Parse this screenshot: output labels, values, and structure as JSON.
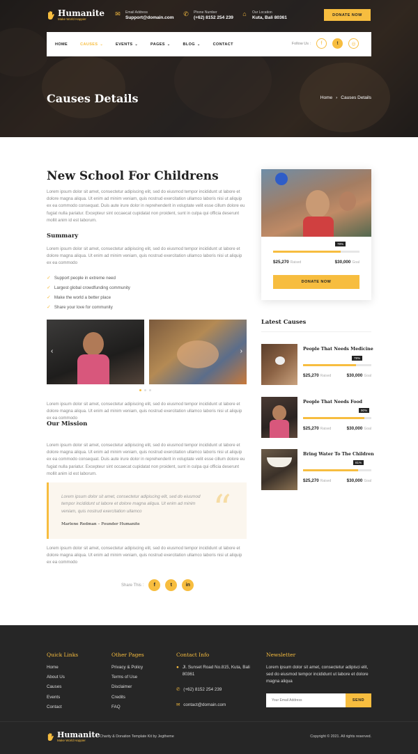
{
  "brand": {
    "name": "Humanite",
    "tagline": "Make World Happier"
  },
  "topinfo": [
    {
      "label": "Email Address",
      "value": "Support@domain.com",
      "icon": "mail-icon"
    },
    {
      "label": "Phone Number",
      "value": "(+62) 8152 254 239",
      "icon": "phone-icon"
    },
    {
      "label": "Our Location",
      "value": "Kuta, Bali 80361",
      "icon": "home-icon"
    }
  ],
  "donate_top": "DONATE NOW",
  "nav": {
    "items": [
      "HOME",
      "CAUSES",
      "EVENTS",
      "PAGES",
      "BLOG",
      "CONTACT"
    ],
    "active": "CAUSES",
    "follow_label": "Follow Us :"
  },
  "hero": {
    "title": "Causes Details",
    "crumb_home": "Home",
    "crumb_current": "Causes Details"
  },
  "main": {
    "title": "New School For Childrens",
    "intro": "Lorem ipsum dolor sit amet, consectetur adipiscing elit, sed do eiusmod tempor incididunt ut labore et dolore magna aliqua. Ut enim ad minim veniam, quis nostrud exercitation ullamco laboris nisi ut aliquip ex ea commodo consequat. Duis aute irure dolor in reprehenderit in voluptate velit esse cillum dolore eu fugiat nulla pariatur. Excepteur sint occaecat cupidatat non proident, sunt in culpa qui officia deserunt mollit anim id est laborum.",
    "summary_title": "Summary",
    "summary_text": "Lorem ipsum dolor sit amet, consectetur adipiscing elit, sed do eiusmod tempor incididunt ut labore et dolore magna aliqua. Ut enim ad minim veniam, quis nostrud exercitation ullamco laboris nisi ut aliquip ex ea commodo",
    "bullets": [
      "Support people in extreme need",
      "Largest global crowdfunding community",
      "Make the world a better place",
      "Share your love for community"
    ],
    "after_gallery": "Lorem ipsum dolor sit amet, consectetur adipiscing elit, sed do eiusmod tempor incididunt ut labore et dolore magna aliqua. Ut enim ad minim veniam, quis nostrud exercitation ullamco laboris nisi ut aliquip ex ea commodo",
    "mission_title": "Our Mission",
    "mission_text": "Lorem ipsum dolor sit amet, consectetur adipiscing elit, sed do eiusmod tempor incididunt ut labore et dolore magna aliqua. Ut enim ad minim veniam, quis nostrud exercitation ullamco laboris nisi ut aliquip ex ea commodo consequat. Duis aute irure dolor in reprehenderit in voluptate velit esse cillum dolore eu fugiat nulla pariatur. Excepteur sint occaecat cupidatat non proident, sunt in culpa qui officia deserunt mollit anim id est laborum.",
    "quote_text": "Lorem ipsum dolor sit amet, consectetur adipiscing elit, sed do eiusmod tempor incididunt ut labore et dolore magna aliqua. Ut enim ad minim veniam, quis nostrud exercitation ullamco",
    "quote_author": "Marlene Redman – Founder Humanite",
    "closing": "Lorem ipsum dolor sit amet, consectetur adipiscing elit, sed do eiusmod tempor incididunt ut labore et dolore magna aliqua. Ut enim ad minim veniam, quis nostrud exercitation ullamco laboris nisi ut aliquip ex ea commodo",
    "share_label": "Share This :"
  },
  "donation_card": {
    "progress": 0.78,
    "percent": "78%",
    "raised": "$25,270",
    "raised_label": "Raised",
    "goal": "$30,000",
    "goal_label": "Goal",
    "button": "DONATE NOW"
  },
  "latest": {
    "title": "Latest Causes",
    "items": [
      {
        "title": "People That Needs Medicine",
        "progress": 0.78,
        "percent": "78%",
        "raised": "$25,270",
        "goal": "$30,000"
      },
      {
        "title": "People That Needs Food",
        "progress": 0.9,
        "percent": "90%",
        "raised": "$25,270",
        "goal": "$30,000"
      },
      {
        "title": "Bring Water To The Children",
        "progress": 0.81,
        "percent": "81%",
        "raised": "$25,270",
        "goal": "$30,000"
      }
    ],
    "raised_label": "Raised",
    "goal_label": "Goal"
  },
  "footer": {
    "quick_title": "Quick Links",
    "quick": [
      "Home",
      "About Us",
      "Causes",
      "Events",
      "Contact"
    ],
    "other_title": "Other Pages",
    "other": [
      "Privacy & Policy",
      "Terms of Use",
      "Disclaimer",
      "Credits",
      "FAQ"
    ],
    "contact_title": "Contact Info",
    "address": "Jl. Sunset Road No.815, Kuta, Bali 80361",
    "phone": "(+62) 8152 254 239",
    "email": "contact@domain.com",
    "news_title": "Newsletter",
    "news_text": "Lorem ipsum dolor sit amet, consectetur adipisci elit, sed do eiusmod tempor incididunt ut labore et dolore magna aliqua",
    "news_placeholder": "Your Email Address",
    "news_button": "SEND",
    "kit": "Charity & Donation Template Kit by Jegtheme",
    "copyright": "Copyright © 2021. All rights reserved."
  }
}
